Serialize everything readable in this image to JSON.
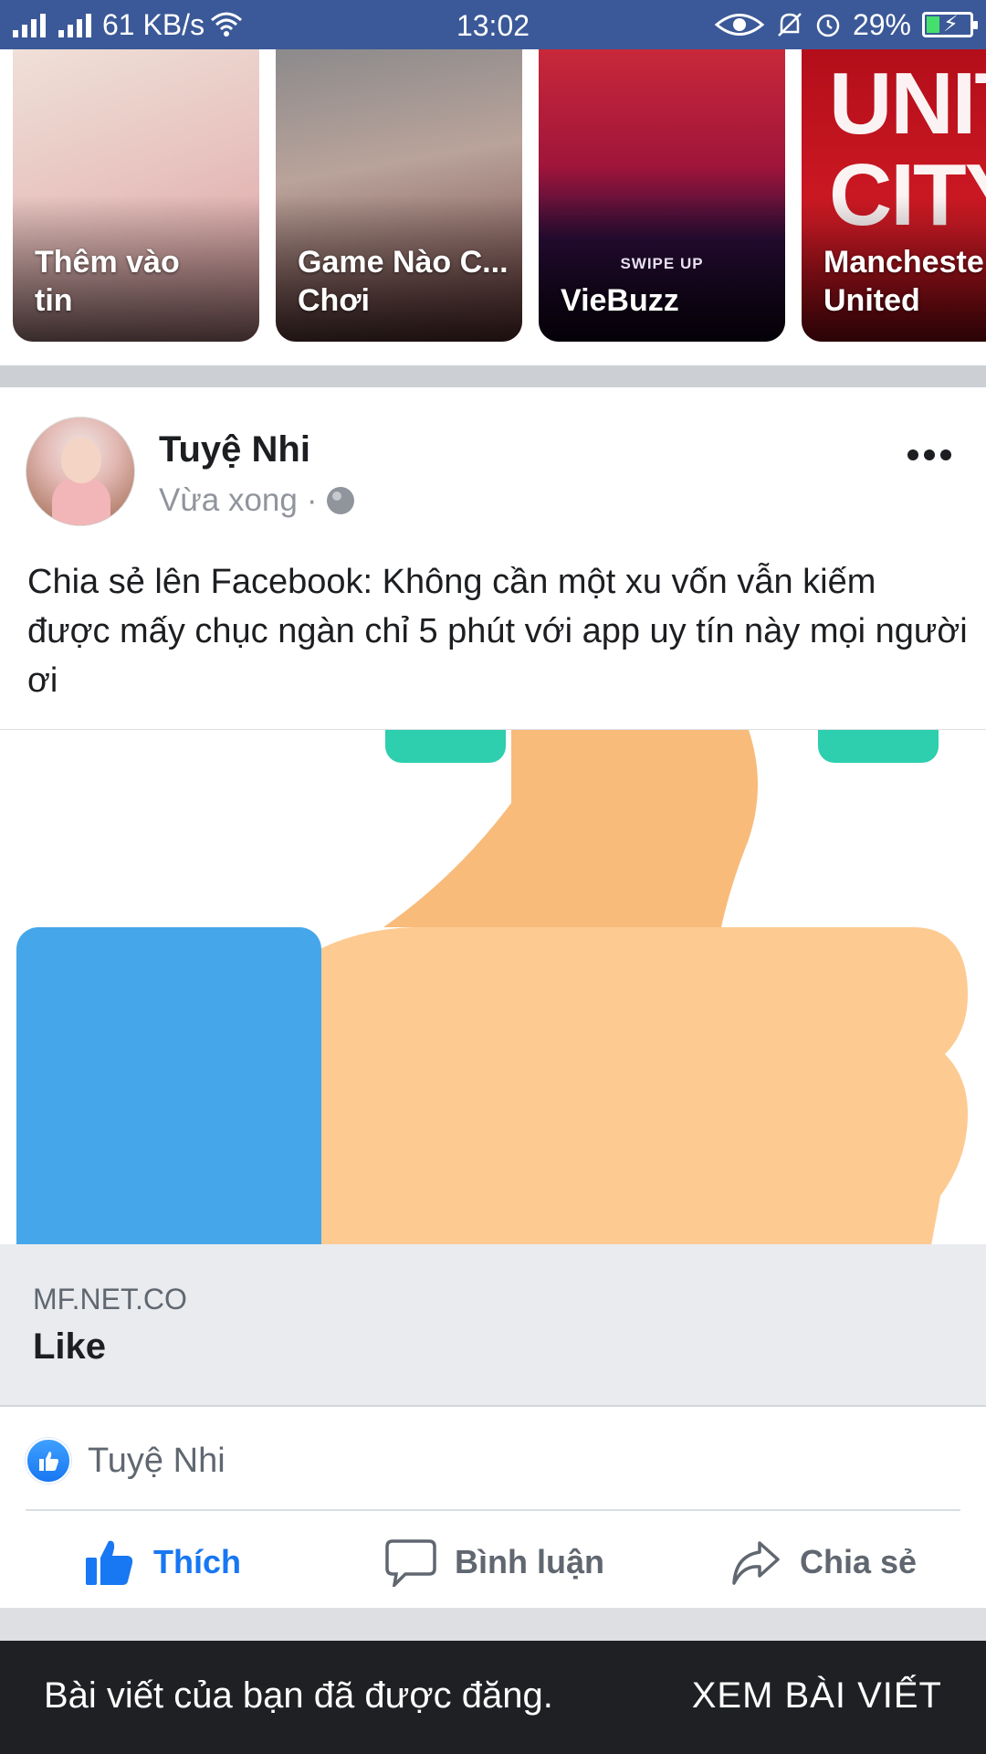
{
  "status_bar": {
    "speed": "61 KB/s",
    "time": "13:02",
    "battery": "29%"
  },
  "stories": [
    {
      "label": "Thêm vào\ntin"
    },
    {
      "label": "Game Nào C...\nChơi"
    },
    {
      "label": "VieBuzz",
      "overlay": "SWIPE UP"
    },
    {
      "label": "Mancheste\nUnited",
      "logo_text": "UNITE\nCITY"
    }
  ],
  "post": {
    "author": "Tuyệ Nhi",
    "time": "Vừa xong",
    "dot": "·",
    "text": "Chia sẻ lên Facebook: Không cần một xu vốn vẫn kiếm được mấy chục ngàn chỉ 5 phút với app uy tín này mọi người ơi",
    "link_domain": "MF.NET.CO",
    "link_title": "Like",
    "reactions_name": "Tuyệ Nhi",
    "actions": {
      "like": "Thích",
      "comment": "Bình luận",
      "share": "Chia sẻ"
    }
  },
  "snackbar": {
    "message": "Bài viết của bạn đã được đăng.",
    "action": "XEM BÀI VIẾT"
  },
  "colors": {
    "status_bar": "#3b5998",
    "like_blue": "#1877f2",
    "snackbar": "#1f2023"
  }
}
